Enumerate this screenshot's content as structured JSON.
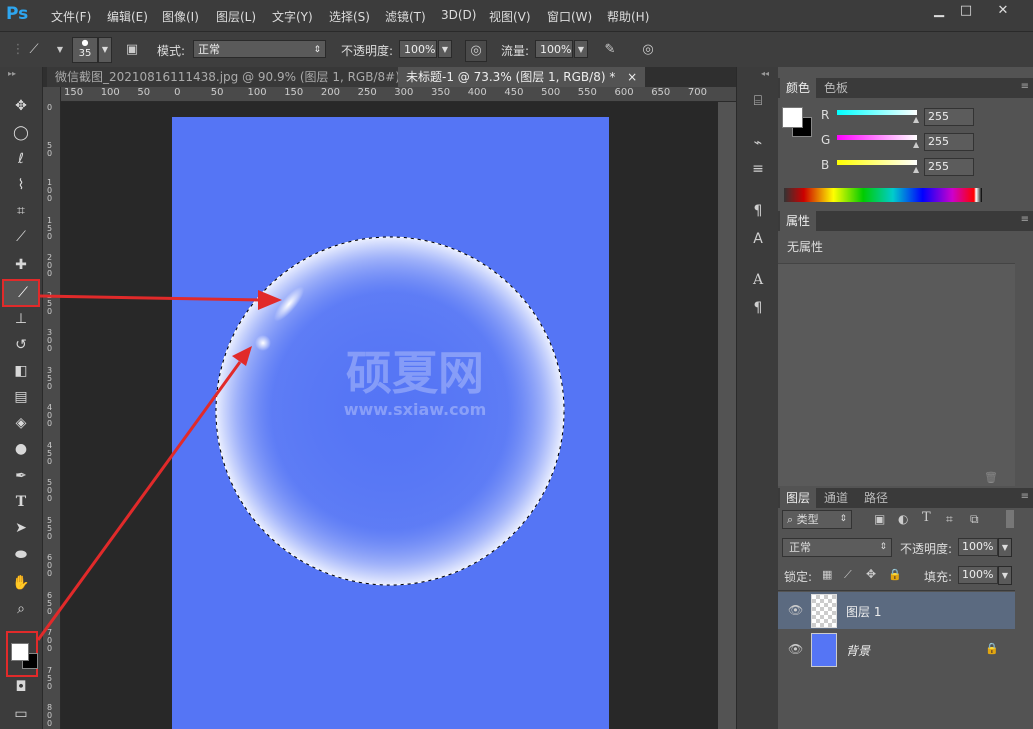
{
  "menubar": {
    "logo": "Ps",
    "items": [
      "文件(F)",
      "编辑(E)",
      "图像(I)",
      "图层(L)",
      "文字(Y)",
      "选择(S)",
      "滤镜(T)",
      "3D(D)",
      "视图(V)",
      "窗口(W)",
      "帮助(H)"
    ],
    "window_buttons": [
      "▁",
      "□",
      "✕"
    ]
  },
  "options": {
    "brush_size": "35",
    "mode_label": "模式:",
    "mode_value": "正常",
    "opacity_label": "不透明度:",
    "opacity_value": "100%",
    "flow_label": "流量:",
    "flow_value": "100%"
  },
  "document": {
    "tabs": [
      {
        "label": "微信截图_20210816111438.jpg @ 90.9% (图层 1, RGB/8#) *",
        "close": "×",
        "active": false
      },
      {
        "label": "未标题-1 @ 73.3% (图层 1, RGB/8) *",
        "close": "×",
        "active": true
      }
    ],
    "ruler_h": [
      "150",
      "100",
      "50",
      "0",
      "50",
      "100",
      "150",
      "200",
      "250",
      "300",
      "350",
      "400",
      "450",
      "500",
      "550",
      "600",
      "650",
      "700"
    ],
    "ruler_v": [
      "0",
      "5 0",
      "1 0 0",
      "1 5 0",
      "2 0 0",
      "2 5 0",
      "3 0 0",
      "3 5 0",
      "4 0 0",
      "4 5 0",
      "5 0 0",
      "5 5 0",
      "6 0 0",
      "6 5 0",
      "7 0 0",
      "7 5 0",
      "8 0 0"
    ],
    "canvas_color": "#5575f5",
    "watermark_title": "硕夏网",
    "watermark_url": "www.sxiaw.com"
  },
  "color_panel": {
    "tabs": [
      "颜色",
      "色板"
    ],
    "channels": [
      {
        "label": "R",
        "value": "255",
        "color": "#00ffff"
      },
      {
        "label": "G",
        "value": "255",
        "color": "#ff00ff"
      },
      {
        "label": "B",
        "value": "255",
        "color": "#ffff00"
      }
    ],
    "foreground": "#ffffff",
    "background": "#000000"
  },
  "properties_panel": {
    "tab": "属性",
    "empty_text": "无属性"
  },
  "layers_panel": {
    "tabs": [
      "图层",
      "通道",
      "路径"
    ],
    "filter_label": "类型",
    "blend_mode": "正常",
    "opacity_label": "不透明度:",
    "opacity_value": "100%",
    "lock_label": "锁定:",
    "fill_label": "填充:",
    "fill_value": "100%",
    "layers": [
      {
        "name": "图层 1",
        "selected": true
      },
      {
        "name": "背景",
        "selected": false
      }
    ]
  },
  "annotations": {
    "arrow_color": "#e12a2a"
  }
}
